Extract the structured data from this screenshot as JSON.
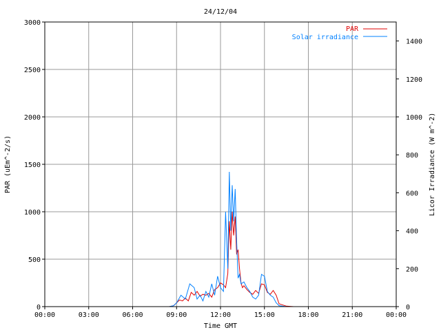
{
  "chart_data": {
    "type": "line",
    "title": "24/12/04",
    "xlabel": "Time GMT",
    "ylabel": "PAR (uEm^-2/s)",
    "y2label": "Licor Irradiance (W m^-2)",
    "x_unit": "hours GMT",
    "xlim": [
      0,
      24
    ],
    "ylim": [
      0,
      3000
    ],
    "y2lim": [
      0,
      1500
    ],
    "x_ticks": [
      {
        "value": 0,
        "label": "00:00"
      },
      {
        "value": 3,
        "label": "03:00"
      },
      {
        "value": 6,
        "label": "06:00"
      },
      {
        "value": 9,
        "label": "09:00"
      },
      {
        "value": 12,
        "label": "12:00"
      },
      {
        "value": 15,
        "label": "15:00"
      },
      {
        "value": 18,
        "label": "18:00"
      },
      {
        "value": 21,
        "label": "21:00"
      },
      {
        "value": 24,
        "label": "00:00"
      }
    ],
    "y_ticks": [
      "0",
      "500",
      "1000",
      "1500",
      "2000",
      "2500",
      "3000"
    ],
    "y2_ticks": [
      "0",
      "200",
      "400",
      "600",
      "800",
      "1000",
      "1200",
      "1400"
    ],
    "y2_tick_values": [
      0,
      200,
      400,
      600,
      800,
      1000,
      1200,
      1400
    ],
    "grid": true,
    "legend_position": "top-right",
    "series": [
      {
        "name": "PAR",
        "axis": "left",
        "color": "#e00000",
        "x": [
          0,
          8.5,
          8.8,
          9.0,
          9.2,
          9.4,
          9.6,
          9.8,
          10.0,
          10.2,
          10.4,
          10.6,
          10.8,
          11.0,
          11.2,
          11.4,
          11.6,
          11.8,
          12.0,
          12.2,
          12.35,
          12.5,
          12.6,
          12.7,
          12.8,
          12.9,
          13.0,
          13.1,
          13.2,
          13.3,
          13.4,
          13.5,
          13.6,
          13.8,
          14.0,
          14.2,
          14.4,
          14.6,
          14.8,
          15.0,
          15.2,
          15.4,
          15.6,
          15.8,
          16.0,
          16.5,
          17.0,
          24.0
        ],
        "y": [
          0,
          0,
          10,
          40,
          70,
          60,
          90,
          60,
          150,
          120,
          160,
          110,
          130,
          120,
          140,
          100,
          180,
          200,
          250,
          230,
          200,
          350,
          900,
          600,
          1000,
          750,
          950,
          550,
          600,
          400,
          250,
          200,
          220,
          180,
          150,
          130,
          170,
          140,
          240,
          230,
          150,
          130,
          170,
          120,
          30,
          5,
          0,
          0
        ]
      },
      {
        "name": "Solar irradiance",
        "axis": "right",
        "color": "#0080ff",
        "x": [
          0,
          8.5,
          8.8,
          9.0,
          9.3,
          9.6,
          9.9,
          10.2,
          10.4,
          10.6,
          10.8,
          11.0,
          11.2,
          11.4,
          11.6,
          11.8,
          12.0,
          12.2,
          12.35,
          12.5,
          12.6,
          12.7,
          12.8,
          12.9,
          13.0,
          13.1,
          13.2,
          13.3,
          13.4,
          13.6,
          13.8,
          14.0,
          14.2,
          14.4,
          14.6,
          14.8,
          15.0,
          15.2,
          15.4,
          15.6,
          15.8,
          16.0,
          16.5,
          17.0,
          24.0
        ],
        "y": [
          0,
          0,
          5,
          20,
          60,
          40,
          120,
          100,
          40,
          60,
          30,
          80,
          50,
          120,
          60,
          160,
          100,
          80,
          500,
          200,
          710,
          400,
          640,
          450,
          620,
          350,
          150,
          170,
          120,
          130,
          100,
          80,
          50,
          40,
          60,
          170,
          160,
          80,
          60,
          50,
          20,
          5,
          0,
          0,
          0
        ]
      }
    ]
  }
}
